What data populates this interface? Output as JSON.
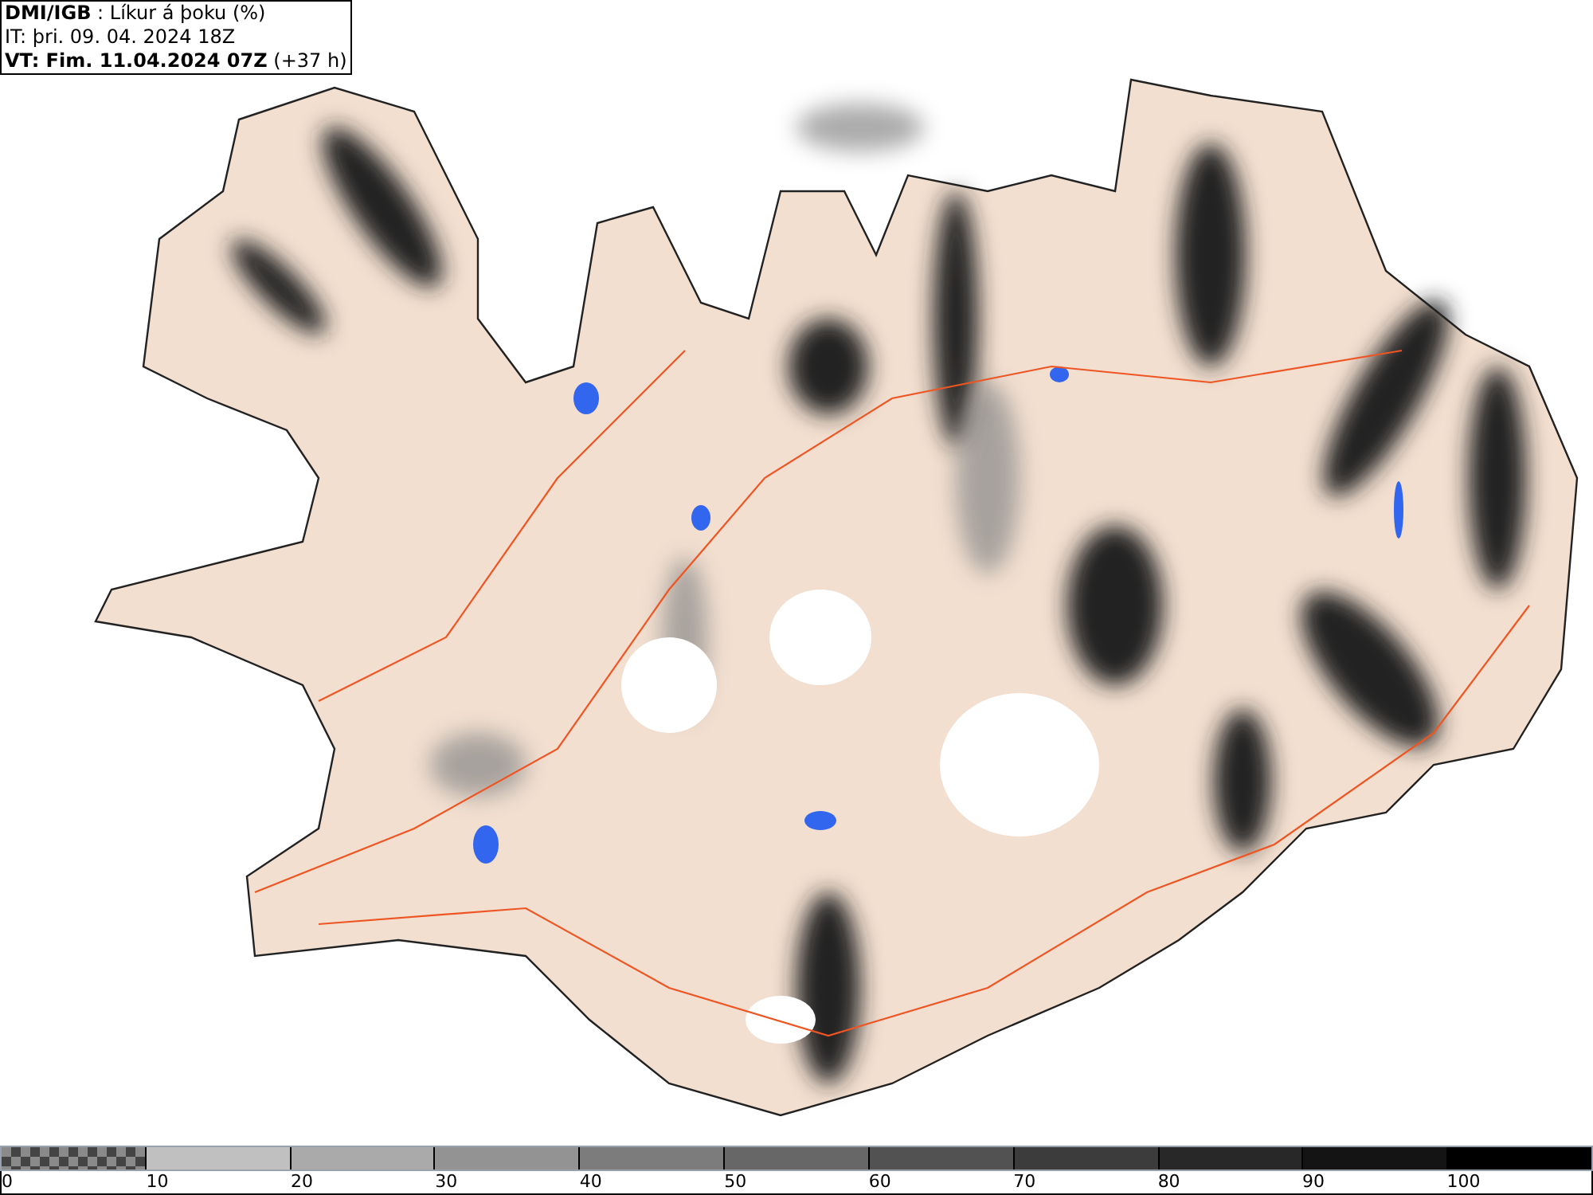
{
  "header": {
    "title": "**DMI/IGB** : Líkur á þoku (%)",
    "issue_time": "IT: þri. 09. 04. 2024 18Z",
    "valid_time": "**VT: Fim. 11.04.2024 07Z** (+37 h)"
  },
  "legend": {
    "segments": [
      {
        "kind": "checker",
        "color": "#8a8a8a"
      },
      {
        "kind": "solid",
        "color": "#c0c0c0"
      },
      {
        "kind": "solid",
        "color": "#aaaaaa"
      },
      {
        "kind": "solid",
        "color": "#939393"
      },
      {
        "kind": "solid",
        "color": "#7c7c7c"
      },
      {
        "kind": "solid",
        "color": "#676767"
      },
      {
        "kind": "solid",
        "color": "#525252"
      },
      {
        "kind": "solid",
        "color": "#3c3c3c"
      },
      {
        "kind": "solid",
        "color": "#282828"
      },
      {
        "kind": "solid",
        "color": "#141414"
      },
      {
        "kind": "solid",
        "color": "#000000"
      }
    ],
    "ticks": [
      "0",
      "10",
      "20",
      "30",
      "40",
      "50",
      "60",
      "70",
      "80",
      "90",
      "100"
    ]
  }
}
